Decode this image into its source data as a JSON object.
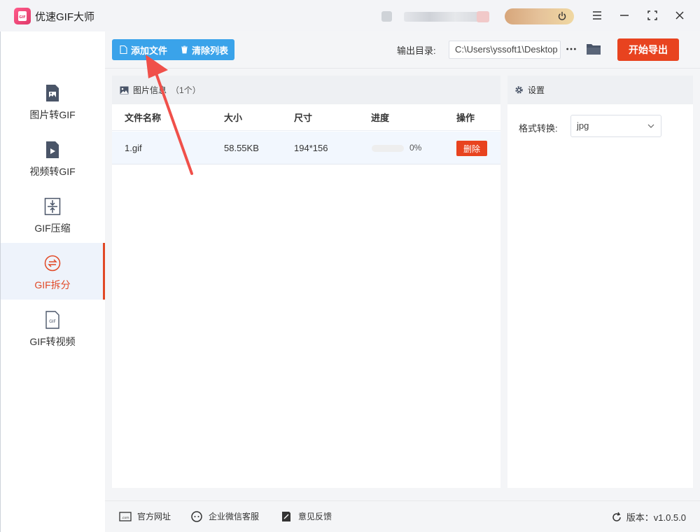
{
  "app": {
    "title": "优速GIF大师"
  },
  "sidebar": {
    "items": [
      {
        "label": "图片转GIF",
        "icon": "image-file-icon"
      },
      {
        "label": "视频转GIF",
        "icon": "video-file-icon"
      },
      {
        "label": "GIF压缩",
        "icon": "compress-icon"
      },
      {
        "label": "GIF拆分",
        "icon": "split-icon",
        "active": true
      },
      {
        "label": "GIF转视频",
        "icon": "gif-file-icon"
      }
    ]
  },
  "toolbar": {
    "add_label": "添加文件",
    "clear_label": "清除列表",
    "output_label": "输出目录:",
    "output_path": "C:\\Users\\yssoft1\\Desktop",
    "export_label": "开始导出"
  },
  "image_panel": {
    "title": "图片信息",
    "count": "（1个）",
    "columns": [
      "文件名称",
      "大小",
      "尺寸",
      "进度",
      "操作"
    ],
    "rows": [
      {
        "name": "1.gif",
        "size": "58.55KB",
        "dimensions": "194*156",
        "progress": "0%",
        "action": "删除",
        "progress_fraction": 0
      }
    ]
  },
  "settings": {
    "title": "设置",
    "format_label": "格式转换:",
    "format_value": "jpg"
  },
  "footer": {
    "website": "官方网址",
    "wechat": "企业微信客服",
    "feedback": "意见反馈",
    "version": "版本：v1.0.5.0"
  },
  "colors": {
    "accent_red": "#e8431f",
    "accent_blue": "#3aa3ea",
    "active_bg": "#eef3fb"
  }
}
